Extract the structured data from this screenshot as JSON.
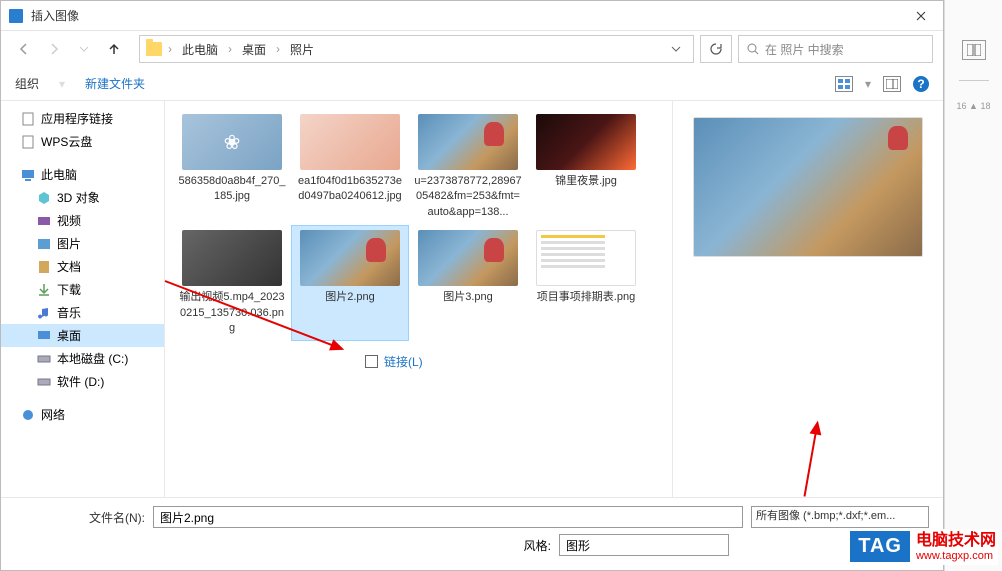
{
  "titlebar": {
    "title": "插入图像"
  },
  "nav": {
    "crumbs": [
      "此电脑",
      "桌面",
      "照片"
    ],
    "search_placeholder": "在 照片 中搜索"
  },
  "toolbar": {
    "organize": "组织",
    "newfolder": "新建文件夹"
  },
  "sidebar": {
    "items": [
      {
        "label": "应用程序链接",
        "icon": "doc",
        "sub": false
      },
      {
        "label": "WPS云盘",
        "icon": "doc",
        "sub": false
      },
      {
        "label": "此电脑",
        "icon": "pc",
        "sub": false
      },
      {
        "label": "3D 对象",
        "icon": "3d",
        "sub": true
      },
      {
        "label": "视频",
        "icon": "video",
        "sub": true
      },
      {
        "label": "图片",
        "icon": "pic",
        "sub": true
      },
      {
        "label": "文档",
        "icon": "docs",
        "sub": true
      },
      {
        "label": "下载",
        "icon": "dl",
        "sub": true
      },
      {
        "label": "音乐",
        "icon": "music",
        "sub": true
      },
      {
        "label": "桌面",
        "icon": "desktop",
        "sub": true,
        "selected": true
      },
      {
        "label": "本地磁盘 (C:)",
        "icon": "disk",
        "sub": true
      },
      {
        "label": "软件 (D:)",
        "icon": "disk",
        "sub": true
      },
      {
        "label": "网络",
        "icon": "net",
        "sub": false
      }
    ]
  },
  "files": [
    {
      "name": "586358d0a8b4f_270_185.jpg",
      "thumb": "t1"
    },
    {
      "name": "ea1f04f0d1b635273ed0497ba0240612.jpg",
      "thumb": "t2"
    },
    {
      "name": "u=2373878772,2896705482&fm=253&fmt=auto&app=138...",
      "thumb": "anime"
    },
    {
      "name": "锦里夜景.jpg",
      "thumb": "night"
    },
    {
      "name": "输出视频5.mp4_20230215_135730.036.png",
      "thumb": "video"
    },
    {
      "name": "图片2.png",
      "thumb": "anime",
      "selected": true
    },
    {
      "name": "图片3.png",
      "thumb": "anime"
    },
    {
      "name": "项目事项排期表.png",
      "thumb": "doc"
    }
  ],
  "link_checkbox": "链接(L)",
  "bottom": {
    "filename_label": "文件名(N):",
    "filename_value": "图片2.png",
    "filetype_value": "所有图像 (*.bmp;*.dxf;*.em...",
    "style_label": "风格:",
    "style_value": "图形"
  },
  "watermark": {
    "badge": "TAG",
    "title": "电脑技术网",
    "url": "www.tagxp.com"
  }
}
